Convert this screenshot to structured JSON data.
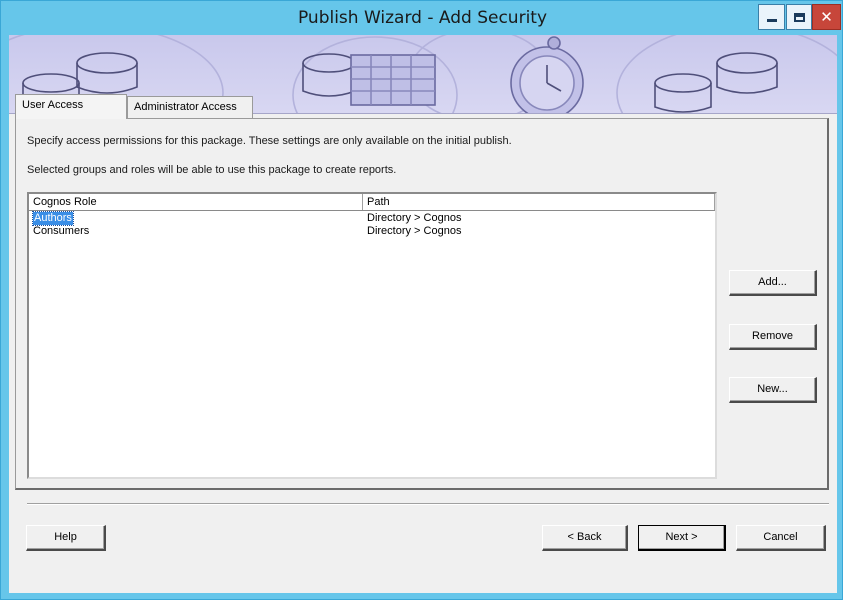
{
  "window": {
    "title": "Publish Wizard - Add Security"
  },
  "tabs": [
    {
      "label": "User Access",
      "active": true
    },
    {
      "label": "Administrator Access",
      "active": false
    }
  ],
  "panel": {
    "description1": "Specify access permissions for this package.  These settings are only available on the initial publish.",
    "description2": "Selected groups and roles will be able to use this package to create reports."
  },
  "list": {
    "columns": [
      "Cognos Role",
      "Path"
    ],
    "rows": [
      {
        "role": "Authors",
        "path": "Directory > Cognos",
        "selected": true
      },
      {
        "role": "Consumers",
        "path": "Directory > Cognos",
        "selected": false
      }
    ]
  },
  "side_buttons": {
    "add": "Add...",
    "remove": "Remove",
    "new": "New..."
  },
  "footer": {
    "help": "Help",
    "back": "< Back",
    "next": "Next >",
    "cancel": "Cancel"
  },
  "colors": {
    "frame": "#66c6ea",
    "banner": "#c9c8ec",
    "close": "#c7463a",
    "selection": "#3a8ee6"
  }
}
